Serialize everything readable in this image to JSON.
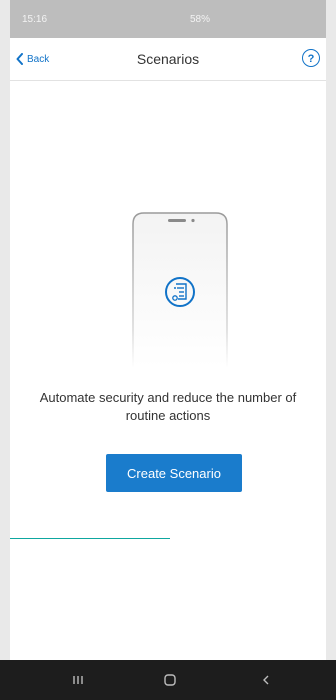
{
  "status_bar": {
    "time": "15:16",
    "icons_text": "58%"
  },
  "header": {
    "back_label": "Back",
    "title": "Scenarios",
    "help_label": "?"
  },
  "main": {
    "illustration_icon": "scenario-list-icon",
    "message": "Automate security and reduce the number of routine actions",
    "cta_label": "Create Scenario"
  },
  "nav_bar": {
    "icons": [
      "recent-apps-icon",
      "home-icon",
      "back-icon"
    ]
  },
  "colors": {
    "accent": "#1173c8",
    "button": "#1a7ccc",
    "teal_line": "#0ea7a0",
    "navbar": "#1d1d1d"
  }
}
